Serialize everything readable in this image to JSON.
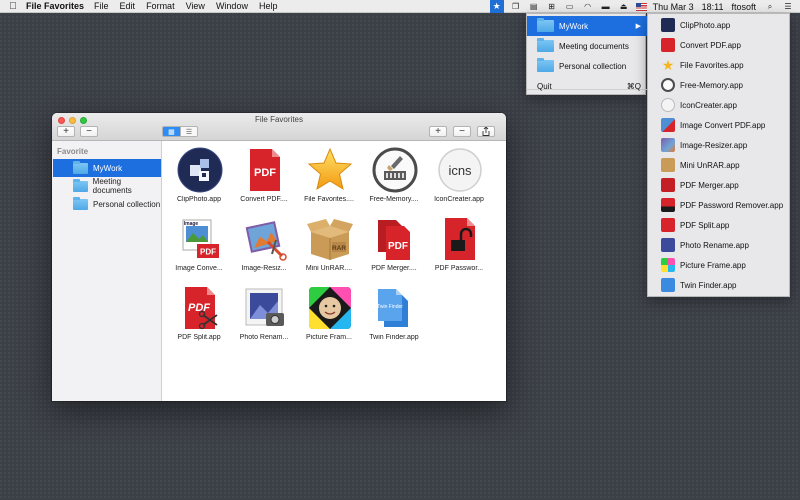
{
  "menubar": {
    "app_name": "File Favorites",
    "menus": [
      "File",
      "Edit",
      "Format",
      "View",
      "Window",
      "Help"
    ],
    "date": "Thu Mar 3",
    "time": "18:11",
    "user": "ftosoft"
  },
  "status_menu": {
    "items": [
      {
        "label": "MyWork",
        "selected": true
      },
      {
        "label": "Meeting documents"
      },
      {
        "label": "Personal collection"
      }
    ],
    "quit_label": "Quit",
    "quit_shortcut": "⌘Q"
  },
  "submenu": {
    "items": [
      {
        "label": "ClipPhoto.app",
        "icon": "clipphoto-icon"
      },
      {
        "label": "Convert PDF.app",
        "icon": "convert-pdf-icon"
      },
      {
        "label": "File Favorites.app",
        "icon": "star-icon"
      },
      {
        "label": "Free-Memory.app",
        "icon": "free-memory-icon"
      },
      {
        "label": "IconCreater.app",
        "icon": "icns-icon"
      },
      {
        "label": "Image Convert PDF.app",
        "icon": "image-convert-icon"
      },
      {
        "label": "Image-Resizer.app",
        "icon": "image-resizer-icon"
      },
      {
        "label": "Mini UnRAR.app",
        "icon": "rar-box-icon"
      },
      {
        "label": "PDF Merger.app",
        "icon": "pdf-merger-icon"
      },
      {
        "label": "PDF Password Remover.app",
        "icon": "pdf-lock-icon"
      },
      {
        "label": "PDF Split.app",
        "icon": "pdf-split-icon"
      },
      {
        "label": "Photo Rename.app",
        "icon": "photo-rename-icon"
      },
      {
        "label": "Picture Frame.app",
        "icon": "picture-frame-icon"
      },
      {
        "label": "Twin Finder.app",
        "icon": "twin-finder-icon"
      }
    ]
  },
  "window": {
    "title": "File Favorites",
    "add_label": "+",
    "remove_label": "−"
  },
  "sidebar": {
    "heading": "Favorite",
    "items": [
      {
        "label": "MyWork",
        "selected": true
      },
      {
        "label": "Meeting documents"
      },
      {
        "label": "Personal collection"
      }
    ]
  },
  "grid": {
    "items": [
      {
        "label": "ClipPhoto.app",
        "icon": "clipphoto-icon"
      },
      {
        "label": "Convert PDF....",
        "icon": "convert-pdf-icon"
      },
      {
        "label": "File Favorites....",
        "icon": "star-icon"
      },
      {
        "label": "Free-Memory....",
        "icon": "free-memory-icon"
      },
      {
        "label": "IconCreater.app",
        "icon": "icns-icon"
      },
      {
        "label": "Image Conve...",
        "icon": "image-convert-icon"
      },
      {
        "label": "Image-Resiz...",
        "icon": "image-resizer-icon"
      },
      {
        "label": "Mini UnRAR....",
        "icon": "rar-box-icon"
      },
      {
        "label": "PDF Merger....",
        "icon": "pdf-merger-icon"
      },
      {
        "label": "PDF Passwor...",
        "icon": "pdf-lock-icon"
      },
      {
        "label": "PDF Split.app",
        "icon": "pdf-split-icon"
      },
      {
        "label": "Photo Renam...",
        "icon": "photo-rename-icon"
      },
      {
        "label": "Picture Fram...",
        "icon": "picture-frame-icon"
      },
      {
        "label": "Twin Finder.app",
        "icon": "twin-finder-icon"
      }
    ],
    "icon_text": {
      "pdf": "PDF",
      "icns": "icns",
      "rar": "RAR",
      "image_badge": "Image",
      "twin_finder_badge": "Twin Finder"
    }
  },
  "colors": {
    "accent": "#1d6fe0",
    "pdf_red": "#d6242a",
    "star_gold": "#f5b51e"
  }
}
